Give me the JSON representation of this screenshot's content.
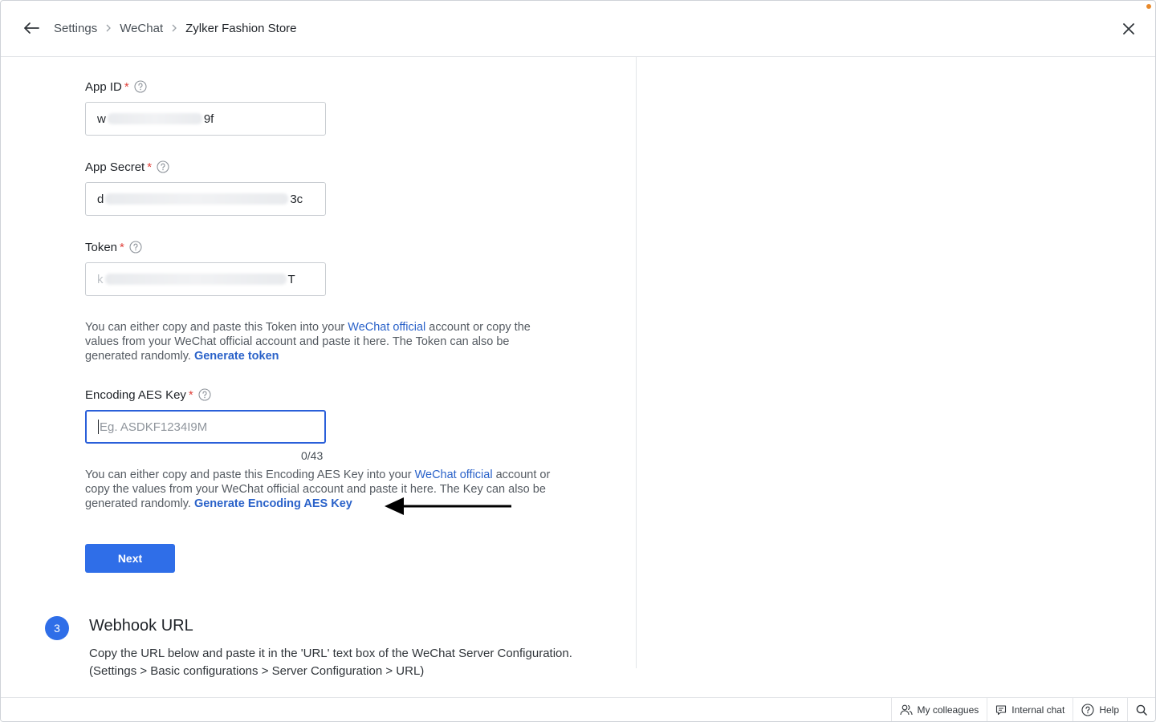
{
  "breadcrumb": {
    "items": [
      "Settings",
      "WeChat",
      "Zylker Fashion Store"
    ]
  },
  "form": {
    "app_id": {
      "label": "App ID",
      "required_mark": "*",
      "value_start": "w",
      "value_end": "9f"
    },
    "app_secret": {
      "label": "App Secret",
      "required_mark": "*",
      "value_start": "d",
      "value_end": "3c"
    },
    "token": {
      "label": "Token",
      "required_mark": "*",
      "value_start": "k",
      "value_end": "T"
    },
    "token_help": {
      "text1": "You can either copy and paste this Token into your ",
      "link1": "WeChat official",
      "text2": " account or copy the values from your WeChat official account and paste it here. The Token can also be generated randomly. ",
      "link2": "Generate token"
    },
    "aes_key": {
      "label": "Encoding AES Key",
      "required_mark": "*",
      "placeholder": "Eg. ASDKF1234I9M",
      "counter": "0/43"
    },
    "aes_help": {
      "text1": "You can either copy and paste this Encoding AES Key into your ",
      "link1": "WeChat official",
      "text2": " account or copy the values from your WeChat official account and paste it here. The Key can also be generated randomly. ",
      "link2": "Generate Encoding AES Key"
    },
    "next_label": "Next"
  },
  "webhook": {
    "step_number": "3",
    "title": "Webhook URL",
    "description_line1": "Copy the URL below and paste it in the 'URL' text box of the WeChat Server Configuration.",
    "description_line2": "(Settings > Basic configurations > Server Configuration > URL)"
  },
  "footer": {
    "colleagues": "My colleagues",
    "internal_chat": "Internal chat",
    "help": "Help"
  },
  "colors": {
    "primary": "#2f6ee8",
    "link": "#2a62c9",
    "required": "#e0413b",
    "notification": "#e8892b"
  },
  "icons": [
    "back-arrow-icon",
    "chevron-right-icon",
    "close-icon",
    "help-circle-icon",
    "left-arrow-annotation-icon",
    "colleagues-icon",
    "chat-icon",
    "help-icon",
    "search-icon"
  ]
}
